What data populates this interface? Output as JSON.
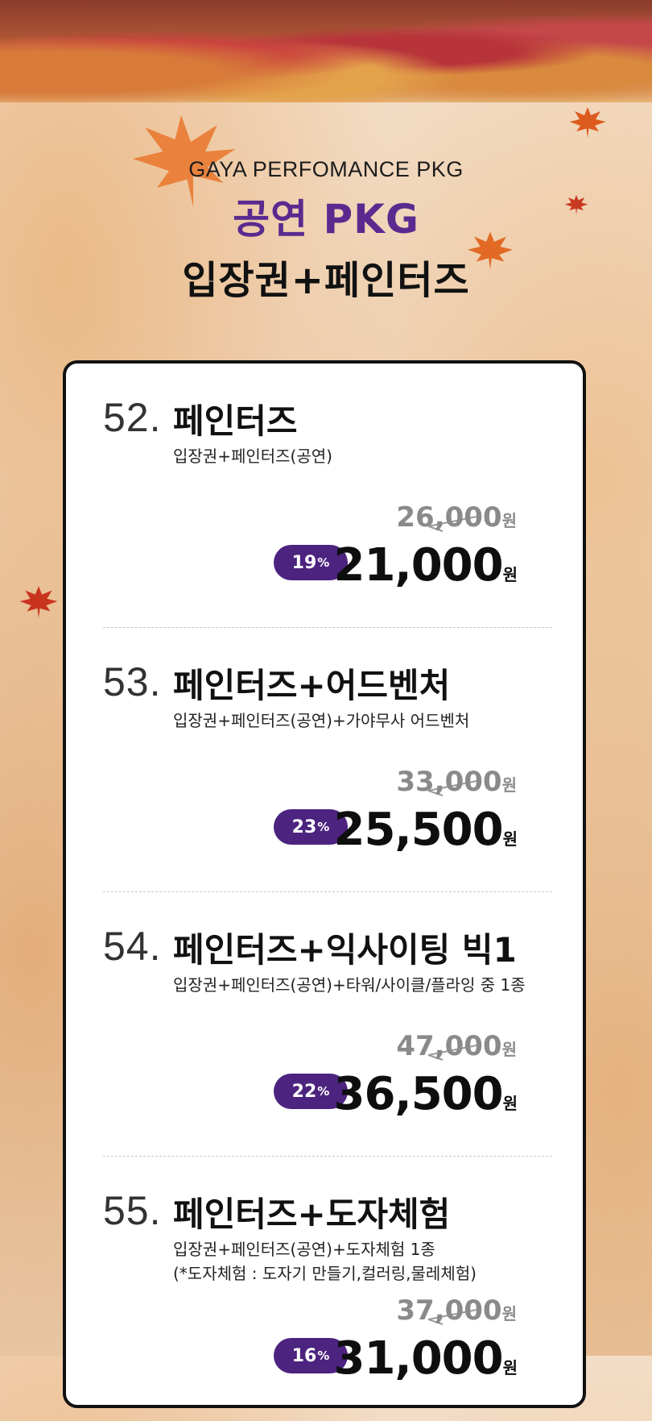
{
  "header": {
    "eng": "GAYA PERFOMANCE PKG",
    "title_purple": "공연 PKG",
    "title_black": "입장권+페인터즈"
  },
  "items": [
    {
      "num": "52.",
      "name": "페인터즈",
      "sub1": "입장권+페인터즈(공연)",
      "sub2": "",
      "orig": "26,000",
      "badge": "19",
      "price": "21,000"
    },
    {
      "num": "53.",
      "name": "페인터즈+어드벤처",
      "sub1": "입장권+페인터즈(공연)+가야무사 어드벤처",
      "sub2": "",
      "orig": "33,000",
      "badge": "23",
      "price": "25,500"
    },
    {
      "num": "54.",
      "name": "페인터즈+익사이팅 빅1",
      "sub1": "입장권+페인터즈(공연)+타워/사이클/플라잉 중 1종",
      "sub2": "",
      "orig": "47,000",
      "badge": "22",
      "price": "36,500"
    },
    {
      "num": "55.",
      "name": "페인터즈+도자체험",
      "sub1": "입장권+페인터즈(공연)+도자체험 1종",
      "sub2": "(*도자체험 : 도자기 만들기,컬러링,물레체험)",
      "orig": "37,000",
      "badge": "16",
      "price": "31,000"
    }
  ],
  "labels": {
    "won": "원",
    "pct": "%"
  },
  "colors": {
    "purple": "#5a2a8f",
    "badge": "#4c237f"
  }
}
